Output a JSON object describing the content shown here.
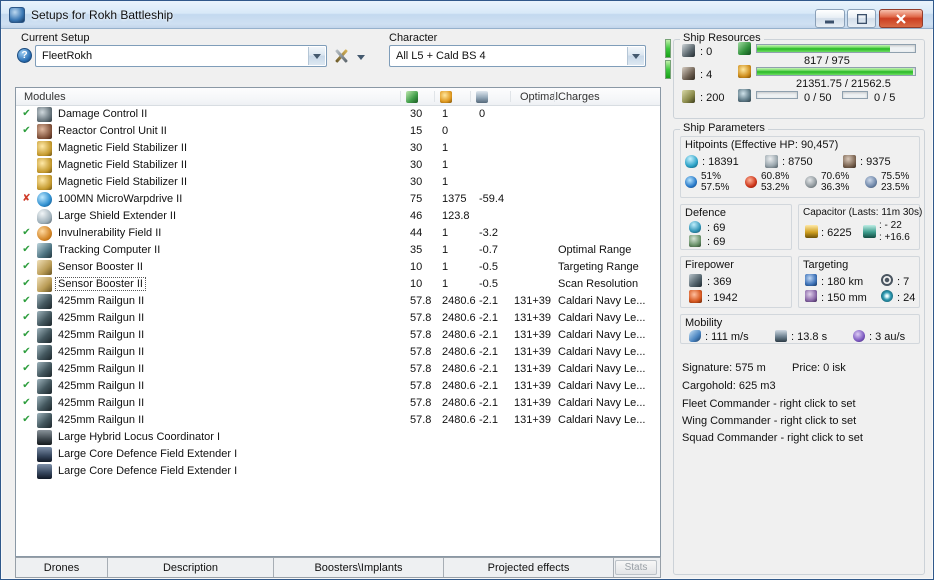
{
  "window": {
    "title": "Setups for Rokh Battleship"
  },
  "icons": {
    "help": "?"
  },
  "setup": {
    "label": "Current Setup",
    "value": "FleetRokh",
    "character_label": "Character",
    "character_value": "All L5 + Cald BS 4"
  },
  "table": {
    "header": {
      "modules": "Modules",
      "optimal": "Optimal",
      "charges": "Charges"
    },
    "state_glyphs": {
      "on": "✔",
      "off": "✘"
    },
    "rows": [
      {
        "state": "on",
        "icon": "damage-control",
        "name": "Damage Control II",
        "cpu": "30",
        "pg": "1",
        "cap": "0",
        "optimal": "",
        "charges": ""
      },
      {
        "state": "on",
        "icon": "reactor-control",
        "name": "Reactor Control Unit II",
        "cpu": "15",
        "pg": "0",
        "cap": "",
        "optimal": "",
        "charges": ""
      },
      {
        "state": "",
        "icon": "mag-stab",
        "name": "Magnetic Field Stabilizer II",
        "cpu": "30",
        "pg": "1",
        "cap": "",
        "optimal": "",
        "charges": ""
      },
      {
        "state": "",
        "icon": "mag-stab",
        "name": "Magnetic Field Stabilizer II",
        "cpu": "30",
        "pg": "1",
        "cap": "",
        "optimal": "",
        "charges": ""
      },
      {
        "state": "",
        "icon": "mag-stab",
        "name": "Magnetic Field Stabilizer II",
        "cpu": "30",
        "pg": "1",
        "cap": "",
        "optimal": "",
        "charges": ""
      },
      {
        "state": "off",
        "icon": "mwd",
        "name": "100MN MicroWarpdrive II",
        "cpu": "75",
        "pg": "1375",
        "cap": "-59.4",
        "optimal": "",
        "charges": ""
      },
      {
        "state": "",
        "icon": "shield-extender",
        "name": "Large Shield Extender II",
        "cpu": "46",
        "pg": "123.8",
        "cap": "",
        "optimal": "",
        "charges": ""
      },
      {
        "state": "on",
        "icon": "invuln",
        "name": "Invulnerability Field II",
        "cpu": "44",
        "pg": "1",
        "cap": "-3.2",
        "optimal": "",
        "charges": ""
      },
      {
        "state": "on",
        "icon": "tracking-computer",
        "name": "Tracking Computer II",
        "cpu": "35",
        "pg": "1",
        "cap": "-0.7",
        "optimal": "",
        "charges": "Optimal Range"
      },
      {
        "state": "on",
        "icon": "sensor-booster",
        "name": "Sensor Booster II",
        "cpu": "10",
        "pg": "1",
        "cap": "-0.5",
        "optimal": "",
        "charges": "Targeting Range"
      },
      {
        "state": "on",
        "icon": "sensor-booster",
        "name": "Sensor Booster II",
        "cpu": "10",
        "pg": "1",
        "cap": "-0.5",
        "optimal": "",
        "charges": "Scan Resolution",
        "selected": true
      },
      {
        "state": "on",
        "icon": "railgun",
        "name": "425mm Railgun II",
        "cpu": "57.8",
        "pg": "2480.6",
        "cap": "-2.1",
        "optimal": "131+39",
        "charges": "Caldari Navy Le..."
      },
      {
        "state": "on",
        "icon": "railgun",
        "name": "425mm Railgun II",
        "cpu": "57.8",
        "pg": "2480.6",
        "cap": "-2.1",
        "optimal": "131+39",
        "charges": "Caldari Navy Le..."
      },
      {
        "state": "on",
        "icon": "railgun",
        "name": "425mm Railgun II",
        "cpu": "57.8",
        "pg": "2480.6",
        "cap": "-2.1",
        "optimal": "131+39",
        "charges": "Caldari Navy Le..."
      },
      {
        "state": "on",
        "icon": "railgun",
        "name": "425mm Railgun II",
        "cpu": "57.8",
        "pg": "2480.6",
        "cap": "-2.1",
        "optimal": "131+39",
        "charges": "Caldari Navy Le..."
      },
      {
        "state": "on",
        "icon": "railgun",
        "name": "425mm Railgun II",
        "cpu": "57.8",
        "pg": "2480.6",
        "cap": "-2.1",
        "optimal": "131+39",
        "charges": "Caldari Navy Le..."
      },
      {
        "state": "on",
        "icon": "railgun",
        "name": "425mm Railgun II",
        "cpu": "57.8",
        "pg": "2480.6",
        "cap": "-2.1",
        "optimal": "131+39",
        "charges": "Caldari Navy Le..."
      },
      {
        "state": "on",
        "icon": "railgun",
        "name": "425mm Railgun II",
        "cpu": "57.8",
        "pg": "2480.6",
        "cap": "-2.1",
        "optimal": "131+39",
        "charges": "Caldari Navy Le..."
      },
      {
        "state": "on",
        "icon": "railgun",
        "name": "425mm Railgun II",
        "cpu": "57.8",
        "pg": "2480.6",
        "cap": "-2.1",
        "optimal": "131+39",
        "charges": "Caldari Navy Le..."
      },
      {
        "state": "",
        "icon": "rig-hybrid",
        "name": "Large Hybrid Locus Coordinator I",
        "cpu": "",
        "pg": "",
        "cap": "",
        "optimal": "",
        "charges": ""
      },
      {
        "state": "",
        "icon": "rig-shield",
        "name": "Large Core Defence Field Extender I",
        "cpu": "",
        "pg": "",
        "cap": "",
        "optimal": "",
        "charges": ""
      },
      {
        "state": "",
        "icon": "rig-shield",
        "name": "Large Core Defence Field Extender I",
        "cpu": "",
        "pg": "",
        "cap": "",
        "optimal": "",
        "charges": ""
      }
    ]
  },
  "tabs": {
    "items": [
      "Drones",
      "Description",
      "Boosters\\Implants",
      "Projected effects"
    ],
    "stats": "Stats"
  },
  "resources": {
    "title": "Ship Resources",
    "turrets_free": ": 0",
    "launchers_free": ": 4",
    "calibration": ": 200",
    "cpu_text": "817 / 975",
    "cpu_pct": 84,
    "pg_text": "21351.75 / 21562.5",
    "pg_pct": 99,
    "drone_bay": "0 / 50",
    "drones_active": "0 / 5"
  },
  "parameters": {
    "title": "Ship Parameters",
    "hitpoints": {
      "label": "Hitpoints (Effective HP: 90,457)",
      "pools": [
        {
          "icon": "shieldhp",
          "value": ": 18391"
        },
        {
          "icon": "armorhp",
          "value": ": 8750"
        },
        {
          "icon": "structhp",
          "value": ": 9375"
        }
      ],
      "resists": [
        {
          "icon": "em",
          "shield": "51%",
          "armor": "57.5%"
        },
        {
          "icon": "therm",
          "shield": "60.8%",
          "armor": "53.2%"
        },
        {
          "icon": "kin",
          "shield": "70.6%",
          "armor": "36.3%"
        },
        {
          "icon": "exp",
          "shield": "75.5%",
          "armor": "23.5%"
        }
      ]
    },
    "defence": {
      "label": "Defence",
      "v1": ": 69",
      "v2": ": 69"
    },
    "capacitor": {
      "label": "Capacitor (Lasts: 11m 30s)",
      "amount": ": 6225",
      "delta_top": ": - 22",
      "delta_bottom": ": +16.6"
    },
    "firepower": {
      "label": "Firepower",
      "volley": ": 369",
      "dps": ": 1942"
    },
    "targeting": {
      "label": "Targeting",
      "range": ": 180 km",
      "max_targets": ": 7",
      "scan_res": ": 150 mm",
      "sensor_strength": ": 24"
    },
    "mobility": {
      "label": "Mobility",
      "speed": ": 111 m/s",
      "align": ": 13.8 s",
      "warp": ": 3 au/s"
    },
    "signature": "Signature: 575 m",
    "price": "Price: 0 isk",
    "cargohold": "Cargohold: 625 m3",
    "fleet_cmd": "Fleet Commander - right click to set",
    "wing_cmd": "Wing Commander - right click to set",
    "squad_cmd": "Squad Commander - right click to set"
  }
}
